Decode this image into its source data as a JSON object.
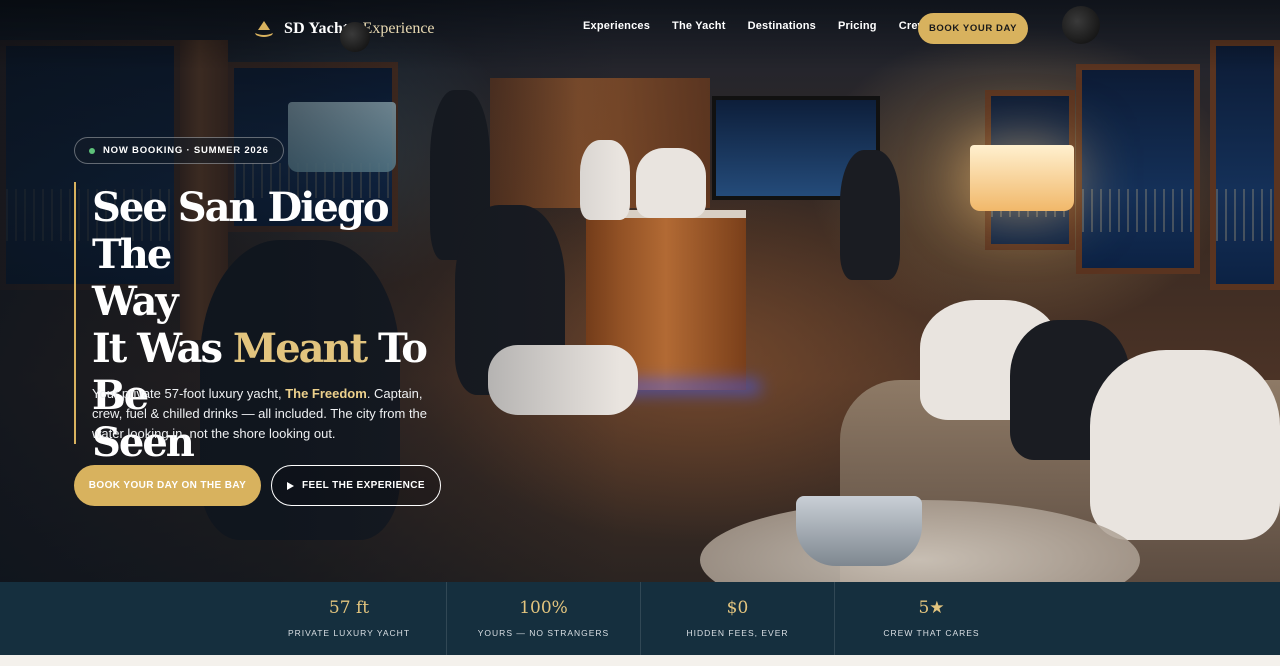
{
  "brand": {
    "name": "SD Yacht",
    "sub": "Experience"
  },
  "nav": {
    "items": [
      "Experiences",
      "The Yacht",
      "Destinations",
      "Pricing",
      "Crew"
    ],
    "cta": "BOOK YOUR DAY"
  },
  "hero": {
    "badge": "NOW BOOKING · SUMMER 2026",
    "title_line1": "See San Diego The",
    "title_line2": "Way",
    "title_line3_pre": "It Was ",
    "title_line3_gold": "Meant",
    "title_line3_post": " To Be",
    "title_line4": "Seen",
    "desc_pre": "Your private 57-foot luxury yacht, ",
    "desc_highlight": "The Freedom",
    "desc_post": ". Captain, crew, fuel & chilled drinks — all included. The city from the water looking in, not the shore looking out.",
    "primary_cta": "BOOK YOUR DAY ON THE BAY",
    "secondary_cta": "FEEL THE EXPERIENCE"
  },
  "stats": [
    {
      "value": "57 ft",
      "label": "PRIVATE LUXURY YACHT"
    },
    {
      "value": "100%",
      "label": "YOURS — NO STRANGERS"
    },
    {
      "value": "$0",
      "label": "HIDDEN FEES, EVER"
    },
    {
      "value": "5★",
      "label": "CREW THAT CARES"
    }
  ],
  "colors": {
    "gold": "#d8b25e",
    "gold_text": "#e2c47e",
    "stats_bg": "#163040"
  }
}
